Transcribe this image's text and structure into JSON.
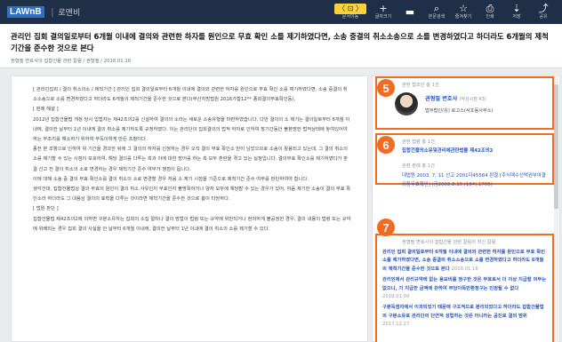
{
  "app": {
    "logo_text": "LAWnB",
    "section": "로앤비"
  },
  "toolbar": [
    {
      "glyph": "〈 ⊡ 〉",
      "label": "문서이동",
      "icon": "document-nav-icon"
    },
    {
      "glyph": "+",
      "label": "글자크기",
      "icon": "font-size-increase-icon"
    },
    {
      "glyph": "▬",
      "label": "",
      "icon": "font-size-decrease-icon"
    },
    {
      "glyph": "⌕",
      "label": "본문검색",
      "icon": "search-icon"
    },
    {
      "glyph": "☆",
      "label": "즐겨찾기",
      "icon": "bookmark-icon"
    },
    {
      "glyph": "⎙",
      "label": "인쇄",
      "icon": "print-icon"
    },
    {
      "glyph": "⇣",
      "label": "저장",
      "icon": "save-icon"
    },
    {
      "glyph": "⤴",
      "label": "공유",
      "icon": "share-icon"
    }
  ],
  "article": {
    "title": "관리인 집회 결의일로부터 6개월 이내에 결의와 관련한 하자를 원인으로 무효 확인 소를 제기하였다면, 소송 중결의 취소소송으로 소를 변경하였다고 하더라도 6개월의 제척기간을 준수한 것으로 본다",
    "meta": "권형필 변호사의 집합건물 관련 칼럼 / 권형필 / 2018.01.16",
    "paragraphs": [
      "[ 관리인집회 / 결의 취소의소 / 제척기간 ] 관리인 집회 결의일로부터 6개월 이내에 결의와 관련한 하자를 원인으로 무효 확인 소를 제기하였다면, 소송 중결의 취소소송으로 소를 변경하였다고 하더라도 6개월의 제척기간을 준수한 것으로 본다(부산지방법원 2016가합12** 종회결의무효확인등).",
      "[ 판례 해설 ]",
      "2012년 집합건물법 개정 당시 입법자는 제42조의2를 신설하여 결의의 소라는 새로운 소송유형을 마련하였습니다. 다만 결의의 소 제기는 결의일로부터 6개월 이내에, 결의한 날부터 1년 이내에 결의 취소를 제기하도록 규정하였다. 이는 관리단의 집회결의의 법적 하자로 인하여 장기간동안 불분명한 법적상태에 놓여있어야 하는 부조리를 해소하기 위하여 부득이하게 만든 조항이다.",
      "종전 본 조항으로 인하여 위 기간을 경과한 뒤에 그 결의의 하자를 인정하는 경우 오직 결의 무효 확인소 만이 남았으므로 소송이 활용되고 있는데, 그 결의 취소의 소를 제기할 수 있는 시점이 모호하여, 해당 결의를 다투는 측과 이에 대한 방어를 하는 측 모두 혼란을 겪고 있는 실정입니다. 결의무효 확인소를 제기하였다가 판결 선고 전 결의 취소의 소로 변경하는 경우 제척기간 준수 여부가 쟁점이 됩니다.",
      "이에 대해 소송 중 결의 무효 확인소를 결의 취소의 소로 변경할 경우 처음 소 제기 시점을 기준으로 제척기간 준수 여부를 판단하여야 합니다.",
      "생각건대, 집합건물법상 결의 무효의 원인이 결의 취소 사유인지 무효인지 불명확하거나 양자 모두에 해당할 수 있는 경우가 있어, 처음 제기한 소송이 결의 무효 확인소라 하더라도 그 내용상 결의의 효력을 다투는 것이라면 제척기간을 준수한 것으로 봄이 타당하다.",
      "[ 법원 판단 ]",
      "집합건물법 제42조의2에 의하면 구분소유자는 집회의 소집 절차나 결의 방법이 법령 또는 규약에 위반되거나 현저하게 불공정한 경우, 결의 내용이 법령 또는 규약에 위배되는 경우 집회 결의 사실을 안 날부터 6개월 이내에, 결의한 날부터 1년 이내에 결의 취소의 소를 제기할 수 있다."
    ]
  },
  "author_box": {
    "label": "관련 법조인 총 1건",
    "name": "권형필 변호사",
    "count": "(작성시점 43)",
    "firm": "법무법인(유) 로고스(서초동사무소)"
  },
  "related_box": {
    "label1": "관련 법령 총 1건",
    "link1": "집합건물의소유및관리에관한법률 제42조의2",
    "label2": "관련 판례 총 1건",
    "link2": "대법원 2003. 7. 11 선고 2001다45584 판결 [주식매수선택권부여결의등무효확인] (공2003.8.15.(184),1705)"
  },
  "posts_box": {
    "label": "권형필 변호사의 집합건물 관련 칼럼의 최신 칼럼",
    "posts": [
      {
        "text": "관리인 집회 결의일로부터 6개월 이내에 결의와 관련한 하자를 원인으로 무효 확인 소를 제기하였다면, 소송 중결의 취소소송으로 소를 변경하였다고 하더라도 6개월의 제척기간을 준수한 것으로 본다",
        "date": "2018.01.16"
      },
      {
        "text": "관리인에서 관리규약에 없는 용보비를 청구한 것은 무효로서 더 이상 지급할 의무는 없으나, 기 지급한 금액에 관하여 부당이득반환청구는 인정될 수 없다",
        "date": "2018.01.09"
      },
      {
        "text": "구분득점자에서 이과되었기 때문에 구조적으로 분리되었다고 하더라도 집합건물법의 구분소유로 관리단의 단연적 성립하는 것은 아니라는 공진로 결의 범위",
        "date": "2017.12.27"
      }
    ]
  }
}
